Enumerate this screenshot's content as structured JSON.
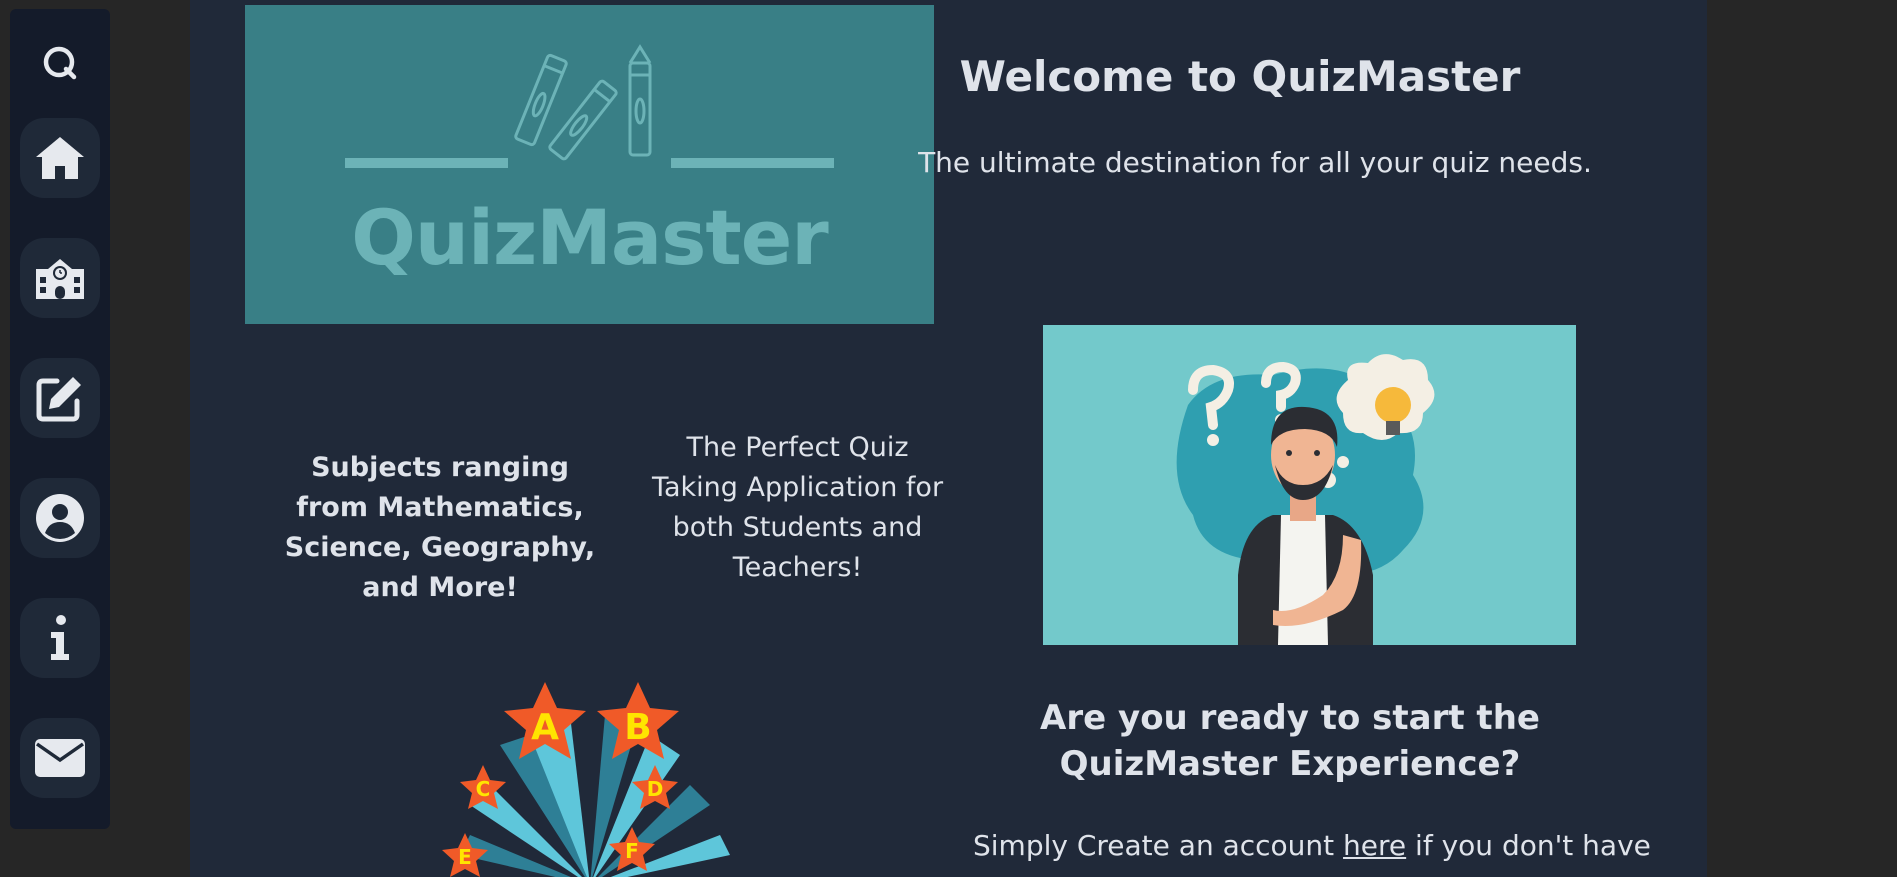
{
  "sidebar": {
    "logo_icon": "q-logo-icon",
    "items": [
      {
        "icon": "home-icon",
        "label": "Home"
      },
      {
        "icon": "school-icon",
        "label": "School"
      },
      {
        "icon": "edit-icon",
        "label": "Create Quiz"
      },
      {
        "icon": "user-icon",
        "label": "Profile"
      },
      {
        "icon": "info-icon",
        "label": "About"
      },
      {
        "icon": "mail-icon",
        "label": "Contact"
      }
    ]
  },
  "hero": {
    "logo_text": "QuizMaster",
    "title": "Welcome to QuizMaster",
    "subtitle": "The ultimate destination for all your quiz needs."
  },
  "features": {
    "subjects": "Subjects ranging from Mathematics, Science, Geography, and More!",
    "perfect": "The Perfect Quiz Taking Application for both Students and Teachers!"
  },
  "cta": {
    "title": "Are you ready to start the QuizMaster Experience?",
    "text_before": "Simply Create an account ",
    "link": "here",
    "text_after": " if you don't have"
  },
  "art": {
    "star_letters": [
      "A",
      "B",
      "C",
      "D",
      "E",
      "F"
    ]
  },
  "colors": {
    "sidebar_bg": "#141b2a",
    "main_bg": "#202939",
    "logo_bg": "#397f86",
    "accent_teal": "#73c9cb",
    "text": "#dfe3ea"
  }
}
